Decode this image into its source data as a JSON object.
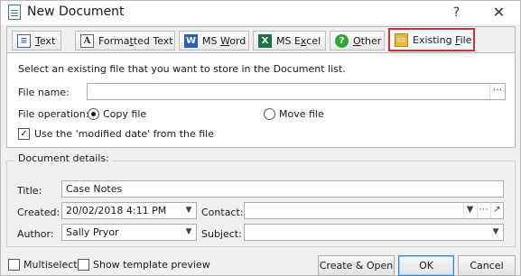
{
  "window": {
    "title": "New Document",
    "help_glyph": "?",
    "close_glyph": "✕"
  },
  "tabs": [
    {
      "label": "Text",
      "icon": "text-doc-icon",
      "icon_glyph": "≡",
      "underline": 0
    },
    {
      "label": "Formatted Text",
      "icon": "formatted-text-icon",
      "icon_glyph": "A",
      "underline": 5
    },
    {
      "label": "MS Word",
      "icon": "word-icon",
      "icon_glyph": "W",
      "underline": 3
    },
    {
      "label": "MS Excel",
      "icon": "excel-icon",
      "icon_glyph": "X",
      "underline": 4
    },
    {
      "label": "Other",
      "icon": "help-circle-icon",
      "icon_glyph": "?",
      "underline": 0
    },
    {
      "label": "Existing File",
      "icon": "folder-file-icon",
      "icon_glyph": "▭",
      "underline": 9,
      "active": true
    }
  ],
  "existing_file": {
    "instruction": "Select an existing file that you want to store in the Document list.",
    "file_name_label": "File name:",
    "file_name_value": "",
    "browse_glyph": "···",
    "file_operation_label": "File operation:",
    "copy_file_label": "Copy file",
    "move_file_label": "Move file",
    "copy_file_selected": true,
    "modified_date_label": "Use the 'modified date' from the file",
    "modified_date_checked": true
  },
  "document_details": {
    "legend": "Document details:",
    "title_label": "Title:",
    "title_value": "Case Notes",
    "created_label": "Created:",
    "created_value": "20/02/2018 4:11 PM",
    "contact_label": "Contact:",
    "contact_value": "",
    "author_label": "Author:",
    "author_value": "Sally Pryor",
    "subject_label": "Subject:",
    "subject_value": ""
  },
  "footer": {
    "multiselect_label": "Multiselect",
    "show_template_label": "Show template preview",
    "create_open_label": "Create & Open",
    "ok_label": "OK",
    "cancel_label": "Cancel"
  }
}
